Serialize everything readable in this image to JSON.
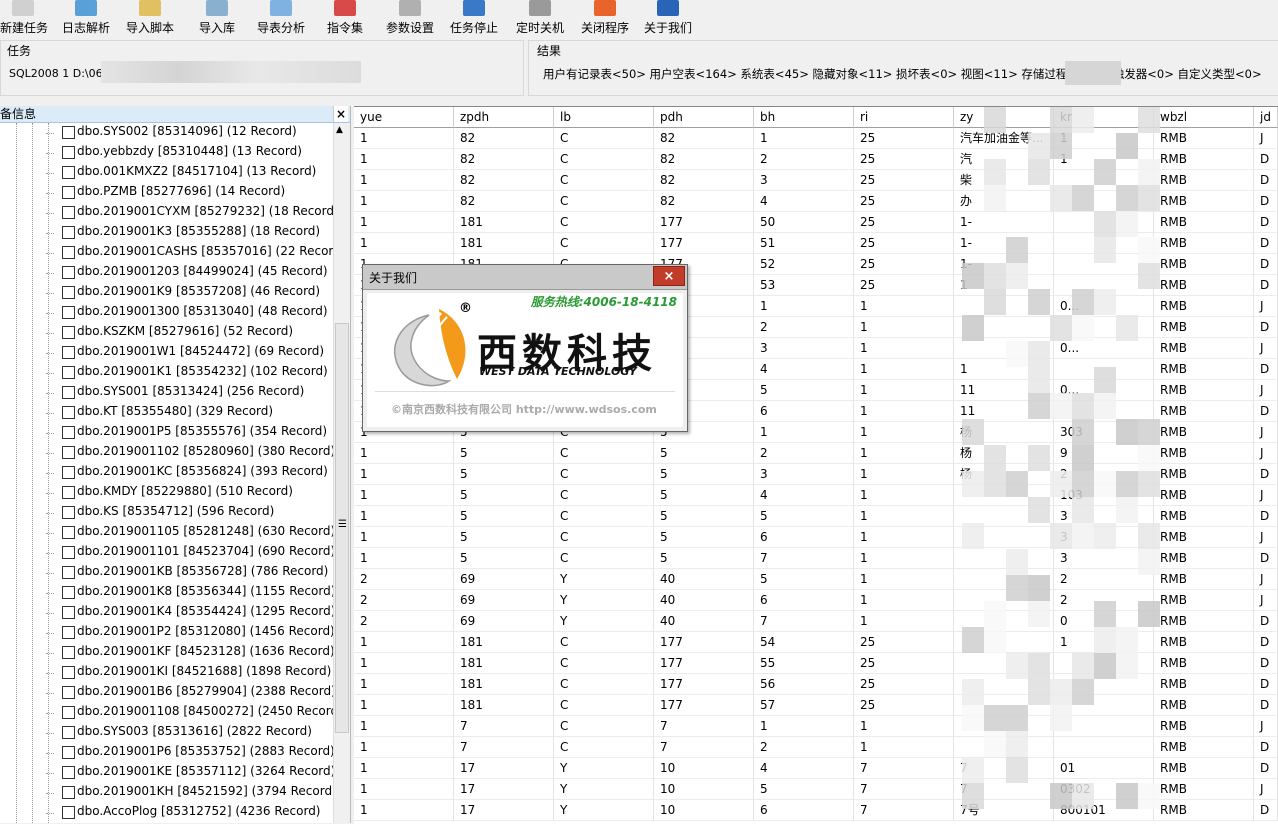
{
  "toolbar": {
    "items": [
      {
        "label": "新建任务",
        "icon": "new-task-icon",
        "color": "#d0d0d0"
      },
      {
        "label": "日志解析",
        "icon": "log-parse-icon",
        "color": "#5aa0d8"
      },
      {
        "label": "导入脚本",
        "icon": "import-script-icon",
        "color": "#e0c060"
      },
      {
        "label": "导入库",
        "icon": "import-db-icon",
        "color": "#8ab0d0"
      },
      {
        "label": "导表分析",
        "icon": "table-analysis-icon",
        "color": "#7fb2e0"
      },
      {
        "label": "指令集",
        "icon": "command-set-icon",
        "color": "#d84a4a"
      },
      {
        "label": "参数设置",
        "icon": "settings-icon",
        "color": "#b0b0b0"
      },
      {
        "label": "任务停止",
        "icon": "stop-icon",
        "color": "#3a78c8"
      },
      {
        "label": "定时关机",
        "icon": "timer-icon",
        "color": "#9a9a9a"
      },
      {
        "label": "关闭程序",
        "icon": "close-program-icon",
        "color": "#e8642a"
      },
      {
        "label": "关于我们",
        "icon": "about-icon",
        "color": "#2a64b8"
      }
    ]
  },
  "task": {
    "title": "任务",
    "text": "SQL2008 1 D:\\062"
  },
  "result": {
    "title": "结果",
    "text": "用户有记录表<50> 用户空表<164> 系统表<45> 隐藏对象<11> 损坏表<0> 视图<11> 存储过程<0> 函        触发器<0> 自定义类型<0>"
  },
  "left_panel": {
    "title": "备信息",
    "close": "×",
    "items": [
      "dbo.SYS002 [85314096] (12 Record)",
      "dbo.yebbzdy [85310448] (13 Record)",
      "dbo.001KMXZ2 [84517104] (13 Record)",
      "dbo.PZMB [85277696] (14 Record)",
      "dbo.2019001CYXM [85279232] (18 Record)",
      "dbo.2019001K3 [85355288] (18 Record)",
      "dbo.2019001CASHS [85357016] (22 Record)",
      "dbo.2019001203 [84499024] (45 Record)",
      "dbo.2019001K9 [85357208] (46 Record)",
      "dbo.2019001300 [85313040] (48 Record)",
      "dbo.KSZKM [85279616] (52 Record)",
      "dbo.2019001W1 [84524472] (69 Record)",
      "dbo.2019001K1 [85354232] (102 Record)",
      "dbo.SYS001 [85313424] (256 Record)",
      "dbo.KT [85355480] (329 Record)",
      "dbo.2019001P5 [85355576] (354 Record)",
      "dbo.2019001102 [85280960] (380 Record)",
      "dbo.2019001KC [85356824] (393 Record)",
      "dbo.KMDY [85229880] (510 Record)",
      "dbo.KS [85354712] (596 Record)",
      "dbo.2019001105 [85281248] (630 Record)",
      "dbo.2019001101 [84523704] (690 Record)",
      "dbo.2019001KB [85356728] (786 Record)",
      "dbo.2019001K8 [85356344] (1155 Record)",
      "dbo.2019001K4 [85354424] (1295 Record)",
      "dbo.2019001P2 [85312080] (1456 Record)",
      "dbo.2019001KF [84523128] (1636 Record)",
      "dbo.2019001KI [84521688] (1898 Record)",
      "dbo.2019001B6 [85279904] (2388 Record)",
      "dbo.2019001108 [84500272] (2450 Record)",
      "dbo.SYS003 [85313616] (2822 Record)",
      "dbo.2019001P6 [85353752] (2883 Record)",
      "dbo.2019001KE [85357112] (3264 Record)",
      "dbo.2019001KH [84521592] (3794 Record)",
      "dbo.AccoPlog [85312752] (4236 Record)"
    ]
  },
  "grid": {
    "columns": [
      "yue",
      "zpdh",
      "lb",
      "pdh",
      "bh",
      "ri",
      "zy",
      "kr",
      "wbzl",
      "jd"
    ],
    "rows": [
      [
        "1",
        "82",
        "C",
        "82",
        "1",
        "25",
        "汽车加油金等...",
        "1",
        "RMB",
        "J"
      ],
      [
        "1",
        "82",
        "C",
        "82",
        "2",
        "25",
        "汽",
        "1",
        "RMB",
        "D"
      ],
      [
        "1",
        "82",
        "C",
        "82",
        "3",
        "25",
        "柴",
        "",
        "RMB",
        "D"
      ],
      [
        "1",
        "82",
        "C",
        "82",
        "4",
        "25",
        "办",
        "",
        "RMB",
        "D"
      ],
      [
        "1",
        "181",
        "C",
        "177",
        "50",
        "25",
        "1-",
        "",
        "RMB",
        "D"
      ],
      [
        "1",
        "181",
        "C",
        "177",
        "51",
        "25",
        "1-",
        "",
        "RMB",
        "D"
      ],
      [
        "1",
        "181",
        "C",
        "177",
        "52",
        "25",
        "1-",
        "",
        "RMB",
        "D"
      ],
      [
        "1",
        "181",
        "C",
        "177",
        "53",
        "25",
        "1",
        "",
        "RMB",
        "D"
      ],
      [
        "1",
        "",
        "",
        "",
        "1",
        "1",
        "",
        "0...",
        "RMB",
        "J"
      ],
      [
        "1",
        "",
        "",
        "",
        "2",
        "1",
        "",
        "",
        "RMB",
        "D"
      ],
      [
        "1",
        "",
        "",
        "",
        "3",
        "1",
        "",
        "0...",
        "RMB",
        "J"
      ],
      [
        "1",
        "",
        "",
        "",
        "4",
        "1",
        "1",
        "",
        "RMB",
        "D"
      ],
      [
        "1",
        "",
        "",
        "",
        "5",
        "1",
        "11",
        "0...",
        "RMB",
        "J"
      ],
      [
        "1",
        "",
        "",
        "",
        "6",
        "1",
        "11",
        "",
        "RMB",
        "D"
      ],
      [
        "1",
        "5",
        "C",
        "5",
        "1",
        "1",
        "杨",
        "303",
        "RMB",
        "J"
      ],
      [
        "1",
        "5",
        "C",
        "5",
        "2",
        "1",
        "杨",
        "9",
        "RMB",
        "J"
      ],
      [
        "1",
        "5",
        "C",
        "5",
        "3",
        "1",
        "杨",
        "2",
        "RMB",
        "D"
      ],
      [
        "1",
        "5",
        "C",
        "5",
        "4",
        "1",
        "",
        "103",
        "RMB",
        "J"
      ],
      [
        "1",
        "5",
        "C",
        "5",
        "5",
        "1",
        "",
        "3",
        "RMB",
        "D"
      ],
      [
        "1",
        "5",
        "C",
        "5",
        "6",
        "1",
        "",
        "3",
        "RMB",
        "J"
      ],
      [
        "1",
        "5",
        "C",
        "5",
        "7",
        "1",
        "",
        "3",
        "RMB",
        "D"
      ],
      [
        "2",
        "69",
        "Y",
        "40",
        "5",
        "1",
        "",
        "2",
        "RMB",
        "J"
      ],
      [
        "2",
        "69",
        "Y",
        "40",
        "6",
        "1",
        "",
        "2",
        "RMB",
        "J"
      ],
      [
        "2",
        "69",
        "Y",
        "40",
        "7",
        "1",
        "",
        "0",
        "RMB",
        "D"
      ],
      [
        "1",
        "181",
        "C",
        "177",
        "54",
        "25",
        "",
        "1",
        "RMB",
        "D"
      ],
      [
        "1",
        "181",
        "C",
        "177",
        "55",
        "25",
        "",
        "",
        "RMB",
        "D"
      ],
      [
        "1",
        "181",
        "C",
        "177",
        "56",
        "25",
        "",
        "",
        "RMB",
        "D"
      ],
      [
        "1",
        "181",
        "C",
        "177",
        "57",
        "25",
        "",
        "",
        "RMB",
        "D"
      ],
      [
        "1",
        "7",
        "C",
        "7",
        "1",
        "1",
        "",
        "",
        "RMB",
        "J"
      ],
      [
        "1",
        "7",
        "C",
        "7",
        "2",
        "1",
        "",
        "",
        "RMB",
        "D"
      ],
      [
        "1",
        "17",
        "Y",
        "10",
        "4",
        "7",
        "7",
        "01",
        "RMB",
        "D"
      ],
      [
        "1",
        "17",
        "Y",
        "10",
        "5",
        "7",
        "7",
        "0302",
        "RMB",
        "J"
      ],
      [
        "1",
        "17",
        "Y",
        "10",
        "6",
        "7",
        "7号",
        "800101",
        "RMB",
        "D"
      ]
    ]
  },
  "about_dialog": {
    "title": "关于我们",
    "close": "×",
    "hotline": "服务热线:4006-18-4118",
    "company_cn": "西数科技",
    "company_en": "WEST DATA TECHNOLOGY",
    "copyright": "©南京西数科技有限公司  http://www.wdsos.com",
    "registered": "®",
    "colors": {
      "accent": "#f39a1b",
      "hotline": "#2b9a34",
      "close": "#c23c2a"
    }
  }
}
